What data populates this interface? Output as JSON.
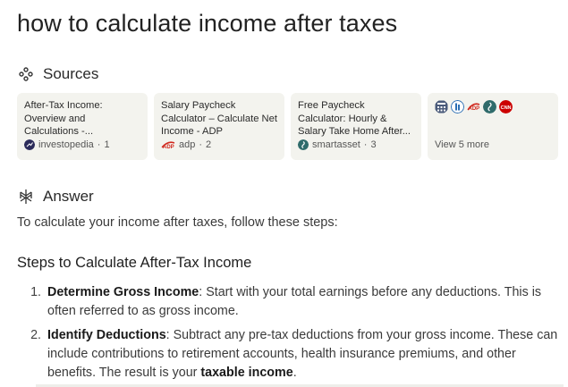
{
  "query": "how to calculate income after taxes",
  "sources": {
    "heading": "Sources",
    "cards": [
      {
        "title": "After-Tax Income: Overview and Calculations -...",
        "source": "investopedia",
        "index": "1"
      },
      {
        "title": "Salary Paycheck Calculator – Calculate Net Income - ADP",
        "source": "adp",
        "index": "2"
      },
      {
        "title": "Free Paycheck Calculator: Hourly & Salary Take Home After...",
        "source": "smartasset",
        "index": "3"
      }
    ],
    "view_more": "View 5 more"
  },
  "answer": {
    "heading": "Answer",
    "intro": "To calculate your income after taxes, follow these steps:",
    "steps_heading": "Steps to Calculate After-Tax Income",
    "steps": [
      {
        "num": "1.",
        "label": "Determine Gross Income",
        "text_a": ": Start with your total earnings before any deductions. This is often referred to as gross income.",
        "emph": "",
        "text_b": ""
      },
      {
        "num": "2.",
        "label": "Identify Deductions",
        "text_a": ": Subtract any pre-tax deductions from your gross income. These can include contributions to retirement accounts, health insurance premiums, and other benefits. The result is your ",
        "emph": "taxable income",
        "text_b": "."
      }
    ]
  },
  "colors": {
    "card_bg": "#f3f3ee",
    "accent": "#2f6b6b"
  },
  "icons": [
    "sources-icon",
    "answer-icon",
    "investopedia-favicon",
    "adp-favicon",
    "smartasset-favicon",
    "calculator-favicon",
    "building-favicon",
    "adp-favicon",
    "smartasset-favicon",
    "cnn-favicon"
  ]
}
